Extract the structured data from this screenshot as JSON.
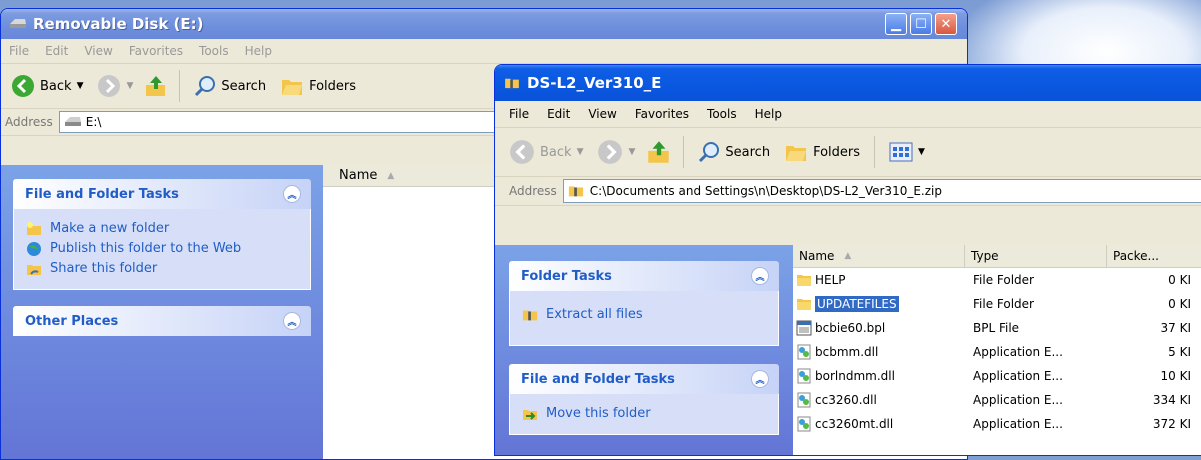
{
  "window1": {
    "title": "Removable Disk (E:)",
    "menu": [
      "File",
      "Edit",
      "View",
      "Favorites",
      "Tools",
      "Help"
    ],
    "toolbar": {
      "back": "Back",
      "search": "Search",
      "folders": "Folders"
    },
    "address": {
      "label": "Address",
      "value": "E:\\"
    },
    "panels": {
      "file_folder_tasks": {
        "title": "File and Folder Tasks",
        "items": [
          "Make a new folder",
          "Publish this folder to the Web",
          "Share this folder"
        ]
      },
      "other_places": {
        "title": "Other Places"
      }
    },
    "columns": {
      "name": "Name"
    }
  },
  "window2": {
    "title": "DS-L2_Ver310_E",
    "menu": [
      "File",
      "Edit",
      "View",
      "Favorites",
      "Tools",
      "Help"
    ],
    "toolbar": {
      "back": "Back",
      "search": "Search",
      "folders": "Folders"
    },
    "address": {
      "label": "Address",
      "value": "C:\\Documents and Settings\\n\\Desktop\\DS-L2_Ver310_E.zip"
    },
    "panels": {
      "folder_tasks": {
        "title": "Folder Tasks",
        "items": [
          "Extract all files"
        ]
      },
      "file_folder_tasks": {
        "title": "File and Folder Tasks",
        "items": [
          "Move this folder"
        ]
      }
    },
    "columns": {
      "name": "Name",
      "type": "Type",
      "packed": "Packe..."
    },
    "files": [
      {
        "name": "HELP",
        "type": "File Folder",
        "packed": "0 KI",
        "icon": "folder-icon"
      },
      {
        "name": "UPDATEFILES",
        "type": "File Folder",
        "packed": "0 KI",
        "icon": "folder-icon",
        "selected": true
      },
      {
        "name": "bcbie60.bpl",
        "type": "BPL File",
        "packed": "37 KI",
        "icon": "bpl-file-icon"
      },
      {
        "name": "bcbmm.dll",
        "type": "Application E...",
        "packed": "5 KI",
        "icon": "dll-file-icon"
      },
      {
        "name": "borlndmm.dll",
        "type": "Application E...",
        "packed": "10 KI",
        "icon": "dll-file-icon"
      },
      {
        "name": "cc3260.dll",
        "type": "Application E...",
        "packed": "334 KI",
        "icon": "dll-file-icon"
      },
      {
        "name": "cc3260mt.dll",
        "type": "Application E...",
        "packed": "372 KI",
        "icon": "dll-file-icon"
      }
    ]
  }
}
